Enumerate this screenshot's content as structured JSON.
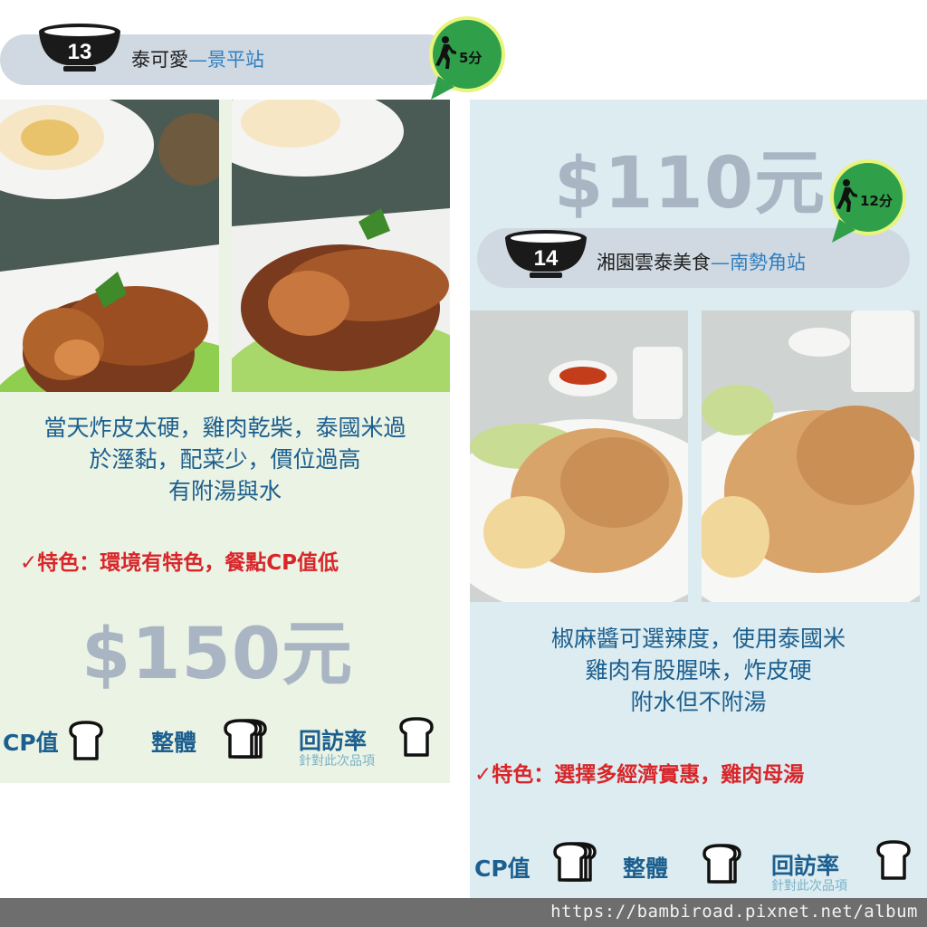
{
  "restaurants": [
    {
      "number": "13",
      "name": "泰可愛",
      "separator": "—",
      "station": "景平站",
      "walk_time": "5分",
      "description_lines": [
        "當天炸皮太硬，雞肉乾柴，泰國米過",
        "於溼黏，配菜少，價位過高",
        "有附湯與水"
      ],
      "feature_check": "✓",
      "feature": "特色：環境有特色，餐點CP值低",
      "price": "$150元",
      "ratings": {
        "cp_label": "CP值",
        "cp_slices": 1,
        "overall_label": "整體",
        "overall_slices": 3,
        "revisit_label": "回訪率",
        "revisit_slices": 1,
        "revisit_note": "針對此次品項"
      }
    },
    {
      "number": "14",
      "name": "湘園雲泰美食",
      "separator": "—",
      "station": "南勢角站",
      "walk_time": "12分",
      "description_lines": [
        "椒麻醬可選辣度，使用泰國米",
        "雞肉有股腥味，炸皮硬",
        "附水但不附湯"
      ],
      "feature_check": "✓",
      "feature": "特色：選擇多經濟實惠，雞肉母湯",
      "price": "$110元",
      "ratings": {
        "cp_label": "CP值",
        "cp_slices": 3,
        "overall_label": "整體",
        "overall_slices": 2,
        "revisit_label": "回訪率",
        "revisit_slices": 1,
        "revisit_note": "針對此次品項"
      }
    }
  ],
  "footer": {
    "url": "https://bambiroad.pixnet.net/album"
  },
  "colors": {
    "bowl": "#1a1a1a",
    "badge_green": "#2f9f4a",
    "accent_blue": "#1c5f8f",
    "feature_red": "#d8262a",
    "price_gray": "#aab5c4"
  },
  "icons": [
    "bowl-icon",
    "walking-person-icon",
    "bread-slice-icon"
  ]
}
